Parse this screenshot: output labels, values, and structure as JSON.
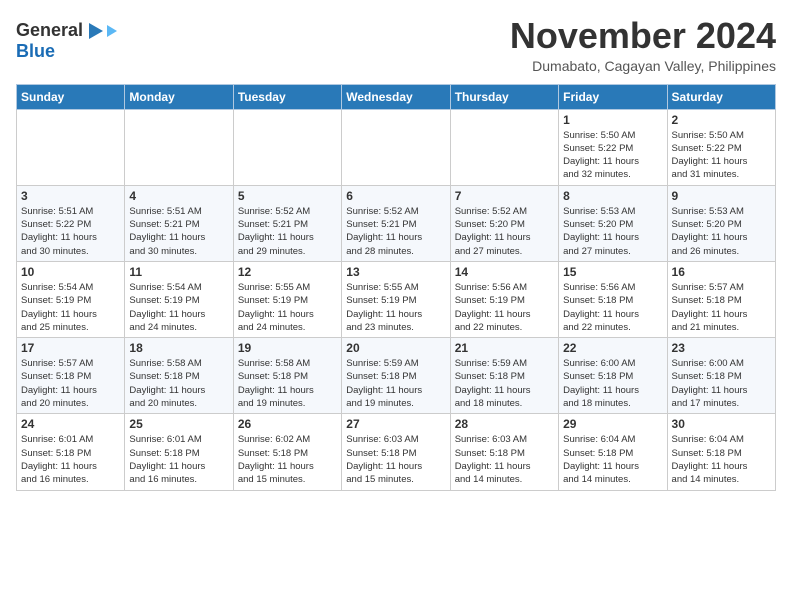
{
  "header": {
    "logo_line1": "General",
    "logo_line2": "Blue",
    "month_title": "November 2024",
    "location": "Dumabato, Cagayan Valley, Philippines"
  },
  "weekdays": [
    "Sunday",
    "Monday",
    "Tuesday",
    "Wednesday",
    "Thursday",
    "Friday",
    "Saturday"
  ],
  "weeks": [
    [
      {
        "day": "",
        "info": ""
      },
      {
        "day": "",
        "info": ""
      },
      {
        "day": "",
        "info": ""
      },
      {
        "day": "",
        "info": ""
      },
      {
        "day": "",
        "info": ""
      },
      {
        "day": "1",
        "info": "Sunrise: 5:50 AM\nSunset: 5:22 PM\nDaylight: 11 hours\nand 32 minutes."
      },
      {
        "day": "2",
        "info": "Sunrise: 5:50 AM\nSunset: 5:22 PM\nDaylight: 11 hours\nand 31 minutes."
      }
    ],
    [
      {
        "day": "3",
        "info": "Sunrise: 5:51 AM\nSunset: 5:22 PM\nDaylight: 11 hours\nand 30 minutes."
      },
      {
        "day": "4",
        "info": "Sunrise: 5:51 AM\nSunset: 5:21 PM\nDaylight: 11 hours\nand 30 minutes."
      },
      {
        "day": "5",
        "info": "Sunrise: 5:52 AM\nSunset: 5:21 PM\nDaylight: 11 hours\nand 29 minutes."
      },
      {
        "day": "6",
        "info": "Sunrise: 5:52 AM\nSunset: 5:21 PM\nDaylight: 11 hours\nand 28 minutes."
      },
      {
        "day": "7",
        "info": "Sunrise: 5:52 AM\nSunset: 5:20 PM\nDaylight: 11 hours\nand 27 minutes."
      },
      {
        "day": "8",
        "info": "Sunrise: 5:53 AM\nSunset: 5:20 PM\nDaylight: 11 hours\nand 27 minutes."
      },
      {
        "day": "9",
        "info": "Sunrise: 5:53 AM\nSunset: 5:20 PM\nDaylight: 11 hours\nand 26 minutes."
      }
    ],
    [
      {
        "day": "10",
        "info": "Sunrise: 5:54 AM\nSunset: 5:19 PM\nDaylight: 11 hours\nand 25 minutes."
      },
      {
        "day": "11",
        "info": "Sunrise: 5:54 AM\nSunset: 5:19 PM\nDaylight: 11 hours\nand 24 minutes."
      },
      {
        "day": "12",
        "info": "Sunrise: 5:55 AM\nSunset: 5:19 PM\nDaylight: 11 hours\nand 24 minutes."
      },
      {
        "day": "13",
        "info": "Sunrise: 5:55 AM\nSunset: 5:19 PM\nDaylight: 11 hours\nand 23 minutes."
      },
      {
        "day": "14",
        "info": "Sunrise: 5:56 AM\nSunset: 5:19 PM\nDaylight: 11 hours\nand 22 minutes."
      },
      {
        "day": "15",
        "info": "Sunrise: 5:56 AM\nSunset: 5:18 PM\nDaylight: 11 hours\nand 22 minutes."
      },
      {
        "day": "16",
        "info": "Sunrise: 5:57 AM\nSunset: 5:18 PM\nDaylight: 11 hours\nand 21 minutes."
      }
    ],
    [
      {
        "day": "17",
        "info": "Sunrise: 5:57 AM\nSunset: 5:18 PM\nDaylight: 11 hours\nand 20 minutes."
      },
      {
        "day": "18",
        "info": "Sunrise: 5:58 AM\nSunset: 5:18 PM\nDaylight: 11 hours\nand 20 minutes."
      },
      {
        "day": "19",
        "info": "Sunrise: 5:58 AM\nSunset: 5:18 PM\nDaylight: 11 hours\nand 19 minutes."
      },
      {
        "day": "20",
        "info": "Sunrise: 5:59 AM\nSunset: 5:18 PM\nDaylight: 11 hours\nand 19 minutes."
      },
      {
        "day": "21",
        "info": "Sunrise: 5:59 AM\nSunset: 5:18 PM\nDaylight: 11 hours\nand 18 minutes."
      },
      {
        "day": "22",
        "info": "Sunrise: 6:00 AM\nSunset: 5:18 PM\nDaylight: 11 hours\nand 18 minutes."
      },
      {
        "day": "23",
        "info": "Sunrise: 6:00 AM\nSunset: 5:18 PM\nDaylight: 11 hours\nand 17 minutes."
      }
    ],
    [
      {
        "day": "24",
        "info": "Sunrise: 6:01 AM\nSunset: 5:18 PM\nDaylight: 11 hours\nand 16 minutes."
      },
      {
        "day": "25",
        "info": "Sunrise: 6:01 AM\nSunset: 5:18 PM\nDaylight: 11 hours\nand 16 minutes."
      },
      {
        "day": "26",
        "info": "Sunrise: 6:02 AM\nSunset: 5:18 PM\nDaylight: 11 hours\nand 15 minutes."
      },
      {
        "day": "27",
        "info": "Sunrise: 6:03 AM\nSunset: 5:18 PM\nDaylight: 11 hours\nand 15 minutes."
      },
      {
        "day": "28",
        "info": "Sunrise: 6:03 AM\nSunset: 5:18 PM\nDaylight: 11 hours\nand 14 minutes."
      },
      {
        "day": "29",
        "info": "Sunrise: 6:04 AM\nSunset: 5:18 PM\nDaylight: 11 hours\nand 14 minutes."
      },
      {
        "day": "30",
        "info": "Sunrise: 6:04 AM\nSunset: 5:18 PM\nDaylight: 11 hours\nand 14 minutes."
      }
    ]
  ]
}
